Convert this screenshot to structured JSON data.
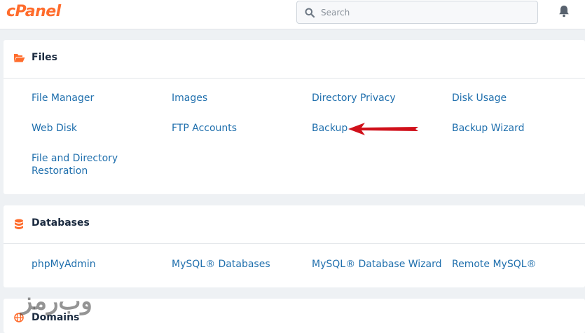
{
  "header": {
    "logo": "cPanel",
    "search_placeholder": "Search"
  },
  "files": {
    "title": "Files",
    "items": [
      "File Manager",
      "Images",
      "Directory Privacy",
      "Disk Usage",
      "Web Disk",
      "FTP Accounts",
      "Backup",
      "Backup Wizard",
      "File and Directory Restoration"
    ]
  },
  "databases": {
    "title": "Databases",
    "items": [
      "phpMyAdmin",
      "MySQL® Databases",
      "MySQL® Database Wizard",
      "Remote MySQL®"
    ]
  },
  "domains": {
    "title": "Domains"
  },
  "watermark": "وب‌رمز",
  "colors": {
    "brand": "#ff6c2c",
    "link": "#1f6fad",
    "annotation_arrow": "#d0101a"
  }
}
